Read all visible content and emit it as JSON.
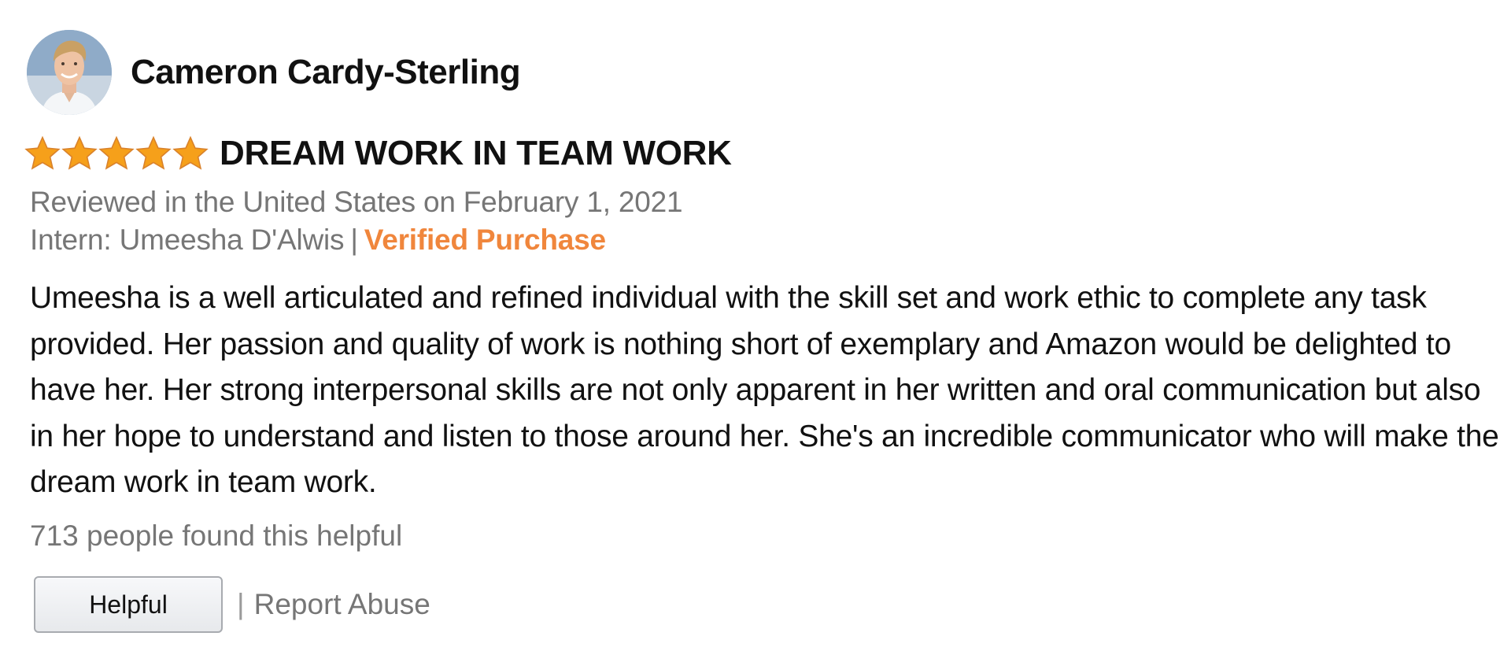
{
  "reviewer": {
    "name": "Cameron Cardy-Sterling"
  },
  "rating": {
    "stars": 5,
    "max_stars": 5,
    "star_color": "#f6a01a"
  },
  "review": {
    "title": "DREAM WORK IN TEAM WORK",
    "reviewed_line": "Reviewed in the United States on February 1, 2021",
    "variant": "Intern: Umeesha D'Alwis",
    "separator": "|",
    "verified": "Verified Purchase",
    "body": "Umeesha is a well articulated and refined individual with the skill set and work ethic to complete any task provided. Her passion and quality of work is nothing short of exemplary and Amazon would be delighted to have her. Her strong interpersonal skills are not only apparent in her written and oral communication but also in her hope to understand and listen to those around her. She's an incredible communicator who will make the dream work in team work.",
    "helpful_count": "713 people found this helpful"
  },
  "actions": {
    "helpful_label": "Helpful",
    "separator": "|",
    "report_label": "Report Abuse"
  },
  "colors": {
    "verified": "#f0863c",
    "muted_text": "#767676",
    "main_text": "#111111"
  }
}
